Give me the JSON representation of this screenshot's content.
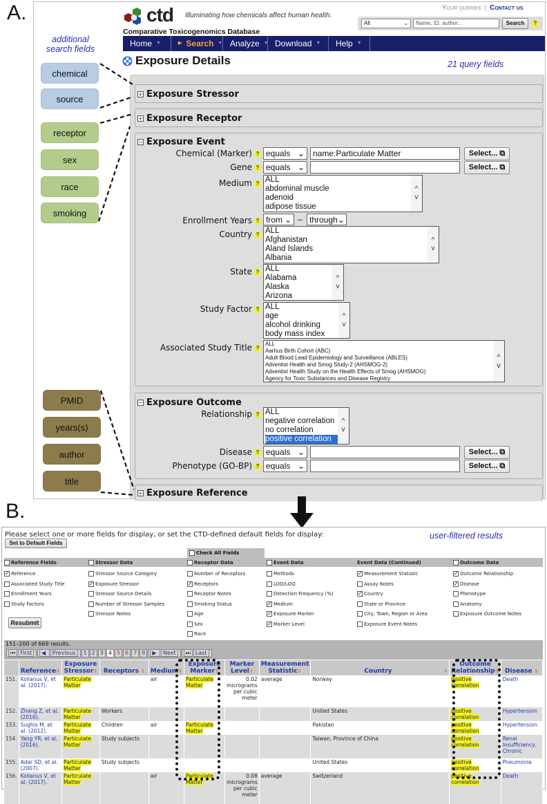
{
  "panel_labels": {
    "a": "A.",
    "b": "B."
  },
  "annotations": {
    "additional_search_fields": "additional search fields",
    "query_fields_count": "21 query fields",
    "user_filtered_results": "user-filtered results"
  },
  "additional_fields": {
    "stressor": [
      "chemical",
      "source"
    ],
    "receptor": [
      "receptor",
      "sex",
      "race",
      "smoking"
    ],
    "reference": [
      "PMID",
      "years(s)",
      "author",
      "title"
    ]
  },
  "colors": {
    "stressor_pill": "#b8cce4",
    "receptor_pill": "#b3cc8c",
    "reference_pill": "#8c7c4c",
    "navbar": "#1a1f6b",
    "nav_active": "#f3a33a",
    "highlight": "#f5f526",
    "link": "#1e3aa8"
  },
  "header": {
    "logo_text": "ctd",
    "tagline": "Illuminating how chemicals affect human health.",
    "brand": "Comparative Toxicogenomics Database",
    "your_queries": "Your queries",
    "contact_us": "Contact us",
    "search_scope": "All",
    "search_placeholder": "Name, ID, author...",
    "search_button": "Search",
    "help": "?"
  },
  "nav": [
    {
      "label": "Home",
      "active": false
    },
    {
      "label": "Search",
      "active": true
    },
    {
      "label": "Analyze",
      "active": false
    },
    {
      "label": "Download",
      "active": false
    },
    {
      "label": "Help",
      "active": false
    }
  ],
  "page_title": "Exposure Details",
  "sections": {
    "stressor": {
      "title": "Exposure Stressor",
      "expanded": false
    },
    "receptor": {
      "title": "Exposure Receptor",
      "expanded": false
    },
    "event": {
      "title": "Exposure Event",
      "expanded": true,
      "chemical": {
        "label": "Chemical (Marker)",
        "operator": "equals",
        "value": "name:Particulate Matter",
        "button": "Select..."
      },
      "gene": {
        "label": "Gene",
        "operator": "equals",
        "value": "",
        "button": "Select..."
      },
      "medium": {
        "label": "Medium",
        "options": [
          "ALL",
          "abdominal muscle",
          "adenoid",
          "adipose tissue"
        ]
      },
      "enrollment": {
        "label": "Enrollment Years",
        "from": "from",
        "sep": "–",
        "through": "through"
      },
      "country": {
        "label": "Country",
        "options": [
          "ALL",
          "Afghanistan",
          "Aland Islands",
          "Albania"
        ]
      },
      "state": {
        "label": "State",
        "options": [
          "ALL",
          "Alabama",
          "Alaska",
          "Arizona"
        ]
      },
      "study_factor": {
        "label": "Study Factor",
        "options": [
          "ALL",
          "age",
          "alcohol drinking",
          "body mass index"
        ]
      },
      "study_title": {
        "label": "Associated Study Title",
        "options": [
          "ALL",
          "Aarhus Birth Cohort (ABC)",
          "Adult Blood Lead Epidemiology and Surveillance (ABLES)",
          "Adventist Health and Smog Study-2 (AHSMOG-2)",
          "Adventist Health Study on the Health Effects of Smog (AHSMOG)",
          "Agency for Toxic Substances and Disease Registry"
        ]
      }
    },
    "outcome": {
      "title": "Exposure Outcome",
      "expanded": true,
      "relationship": {
        "label": "Relationship",
        "options": [
          "ALL",
          "negative correlation",
          "no correlation",
          "positive correlation"
        ],
        "selected": "positive correlation"
      },
      "disease": {
        "label": "Disease",
        "operator": "equals",
        "value": "",
        "button": "Select..."
      },
      "phenotype": {
        "label": "Phenotype (GO-BP)",
        "operator": "equals",
        "value": "",
        "button": "Select..."
      }
    },
    "reference": {
      "title": "Exposure Reference",
      "expanded": false
    }
  },
  "results": {
    "instructions": "Please select one or more fields for display, or set the CTD-defined default fields for display:",
    "default_button": "Set to Default Fields",
    "check_all": "Check All Fields",
    "resubmit": "Resubmit",
    "field_groups": [
      {
        "title": "Reference Fields",
        "has_checkbox": true,
        "checked": false,
        "fields": [
          {
            "label": "Reference",
            "checked": true
          },
          {
            "label": "Associated Study Title",
            "checked": false
          },
          {
            "label": "Enrollment Years",
            "checked": false
          },
          {
            "label": "Study Factors",
            "checked": false
          }
        ]
      },
      {
        "title": "Stressor Data",
        "has_checkbox": true,
        "checked": false,
        "fields": [
          {
            "label": "Stressor Source Category",
            "checked": false
          },
          {
            "label": "Exposure Stressor",
            "checked": true
          },
          {
            "label": "Stressor Source Details",
            "checked": false
          },
          {
            "label": "Number of Stressor Samples",
            "checked": false
          },
          {
            "label": "Stressor Notes",
            "checked": false
          }
        ]
      },
      {
        "title": "Receptor Data",
        "has_checkbox": true,
        "checked": false,
        "fields": [
          {
            "label": "Number of Receptors",
            "checked": false
          },
          {
            "label": "Receptors",
            "checked": true
          },
          {
            "label": "Receptor Notes",
            "checked": false
          },
          {
            "label": "Smoking Status",
            "checked": false
          },
          {
            "label": "Age",
            "checked": false
          },
          {
            "label": "Sex",
            "checked": false
          },
          {
            "label": "Race",
            "checked": false
          }
        ]
      },
      {
        "title": "Event Data",
        "has_checkbox": true,
        "checked": false,
        "fields": [
          {
            "label": "Methods",
            "checked": false
          },
          {
            "label": "LOD/LOQ",
            "checked": false
          },
          {
            "label": "Detection Frequency (%)",
            "checked": false
          },
          {
            "label": "Medium",
            "checked": true
          },
          {
            "label": "Exposure Marker",
            "checked": true
          },
          {
            "label": "Marker Level",
            "checked": true
          }
        ]
      },
      {
        "title": "Event Data (Continued)",
        "has_checkbox": false,
        "checked": false,
        "fields": [
          {
            "label": "Measurement Statistic",
            "checked": true
          },
          {
            "label": "Assay Notes",
            "checked": false
          },
          {
            "label": "Country",
            "checked": true
          },
          {
            "label": "State or Province",
            "checked": false
          },
          {
            "label": "City, Town, Region or Area",
            "checked": false
          },
          {
            "label": "Exposure Event Notes",
            "checked": false
          }
        ]
      },
      {
        "title": "Outcome Data",
        "has_checkbox": true,
        "checked": false,
        "fields": [
          {
            "label": "Outcome Relationship",
            "checked": true
          },
          {
            "label": "Disease",
            "checked": true
          },
          {
            "label": "Phenotype",
            "checked": false
          },
          {
            "label": "Anatomy",
            "checked": false
          },
          {
            "label": "Exposure Outcome Notes",
            "checked": false
          }
        ]
      }
    ],
    "summary": "151–200 of 669 results.",
    "pager": {
      "first": "First",
      "previous": "Previous",
      "pages": [
        "1",
        "2",
        "3",
        "4",
        "5",
        "6",
        "7",
        "8"
      ],
      "current": "4",
      "next": "Next",
      "last": "Last"
    },
    "columns": [
      "",
      "Reference",
      "Exposure Stressor",
      "Receptors",
      "Medium",
      "Exposure Marker",
      "Marker Level",
      "Measurement Statistic",
      "Country",
      "Outcome Relationship",
      "Disease"
    ],
    "rows": [
      {
        "num": "151.",
        "reference": "Kollanus V, et al. (2017).",
        "stressor": "Particulate Matter",
        "receptors": "",
        "medium": "air",
        "marker": "Particulate Matter",
        "level": "0.02 micrograms per cubic meter",
        "statistic": "average",
        "country": "Norway",
        "relationship": "positive correlation",
        "disease": "Death"
      },
      {
        "num": "152.",
        "reference": "Zhang Z, et al. (2016).",
        "stressor": "Particulate Matter",
        "receptors": "Workers",
        "medium": "",
        "marker": "",
        "level": "",
        "statistic": "",
        "country": "United States",
        "relationship": "positive correlation",
        "disease": "Hypertension"
      },
      {
        "num": "153.",
        "reference": "Sughis M, et al. (2012).",
        "stressor": "Particulate Matter",
        "receptors": "Children",
        "medium": "air",
        "marker": "Particulate Matter",
        "level": "",
        "statistic": "",
        "country": "Pakistan",
        "relationship": "positive correlation",
        "disease": "Hypertension"
      },
      {
        "num": "154.",
        "reference": "Yang YR, et al. (2016).",
        "stressor": "Particulate Matter",
        "receptors": "Study subjects",
        "medium": "",
        "marker": "",
        "level": "",
        "statistic": "",
        "country": "Taiwan, Province of China",
        "relationship": "positive correlation",
        "disease": "Renal Insufficiency, Chronic"
      },
      {
        "num": "155.",
        "reference": "Adar SD, et al. (2007).",
        "stressor": "Particulate Matter",
        "receptors": "Study subjects",
        "medium": "",
        "marker": "",
        "level": "",
        "statistic": "",
        "country": "United States",
        "relationship": "positive correlation",
        "disease": "Pneumonia"
      },
      {
        "num": "156.",
        "reference": "Kollanus V, et al. (2017).",
        "stressor": "Particulate Matter",
        "receptors": "",
        "medium": "air",
        "marker": "Particulate Matter",
        "level": "0.08 micrograms per cubic meter",
        "statistic": "average",
        "country": "Switzerland",
        "relationship": "positive correlation",
        "disease": "Death"
      }
    ]
  }
}
